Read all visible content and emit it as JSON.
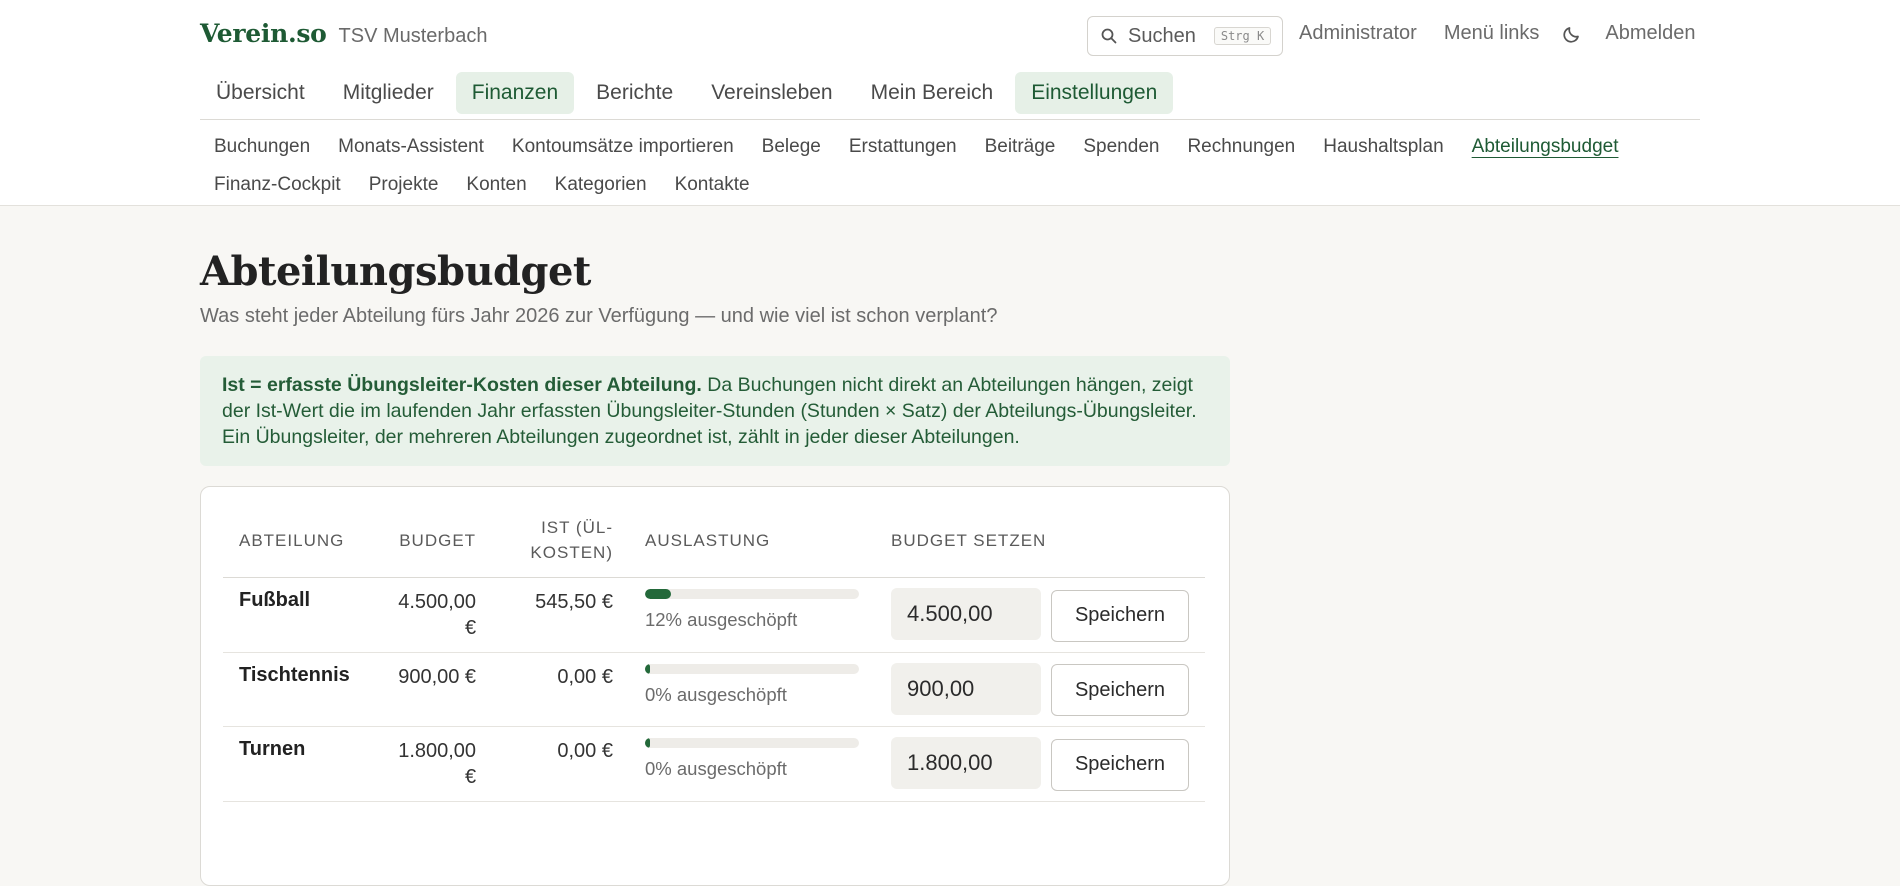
{
  "header": {
    "brand": "Verein.so",
    "club": "TSV Musterbach",
    "search_label": "Suchen",
    "search_shortcut": "Strg K",
    "links": {
      "admin": "Administrator",
      "menu": "Menü links",
      "logout": "Abmelden"
    }
  },
  "main_nav": [
    {
      "label": "Übersicht"
    },
    {
      "label": "Mitglieder"
    },
    {
      "label": "Finanzen"
    },
    {
      "label": "Berichte"
    },
    {
      "label": "Vereinsleben"
    },
    {
      "label": "Mein Bereich"
    },
    {
      "label": "Einstellungen"
    }
  ],
  "sub_nav": {
    "row1": [
      "Buchungen",
      "Monats-Assistent",
      "Kontoumsätze importieren",
      "Belege",
      "Erstattungen",
      "Beiträge",
      "Spenden",
      "Rechnungen",
      "Haushaltsplan",
      "Abteilungsbudget"
    ],
    "row2": [
      "Finanz-Cockpit",
      "Projekte",
      "Konten",
      "Kategorien",
      "Kontakte"
    ]
  },
  "page": {
    "title": "Abteilungsbudget",
    "subtitle": "Was steht jeder Abteilung fürs Jahr 2026 zur Verfügung — und wie viel ist schon verplant?",
    "info_bold": "Ist = erfasste Übungsleiter-Kosten dieser Abteilung.",
    "info_text": " Da Buchungen nicht direkt an Abteilungen hängen, zeigt der Ist-Wert die im laufenden Jahr erfassten Übungsleiter-Stunden (Stunden × Satz) der Abteilungs-Übungsleiter. Ein Übungsleiter, der mehreren Abteilungen zugeordnet ist, zählt in jeder dieser Abteilungen."
  },
  "table": {
    "headers": {
      "dept": "ABTEILUNG",
      "budget": "BUDGET",
      "actual": "IST (ÜL-KOSTEN)",
      "util": "AUSLASTUNG",
      "set": "BUDGET SETZEN"
    },
    "save_label": "Speichern",
    "rows": [
      {
        "name": "Fußball",
        "budget": "4.500,00 €",
        "actual": "545,50 €",
        "util_pct": 12,
        "util_text": "12% ausgeschöpft",
        "input": "4.500,00"
      },
      {
        "name": "Tischtennis",
        "budget": "900,00 €",
        "actual": "0,00 €",
        "util_pct": 0,
        "util_text": "0% ausgeschöpft",
        "input": "900,00"
      },
      {
        "name": "Turnen",
        "budget": "1.800,00 €",
        "actual": "0,00 €",
        "util_pct": 0,
        "util_text": "0% ausgeschöpft",
        "input": "1.800,00"
      }
    ]
  },
  "colors": {
    "accent": "#1e5a34",
    "bar": "#23693a",
    "info_bg": "#e9f2ea"
  }
}
